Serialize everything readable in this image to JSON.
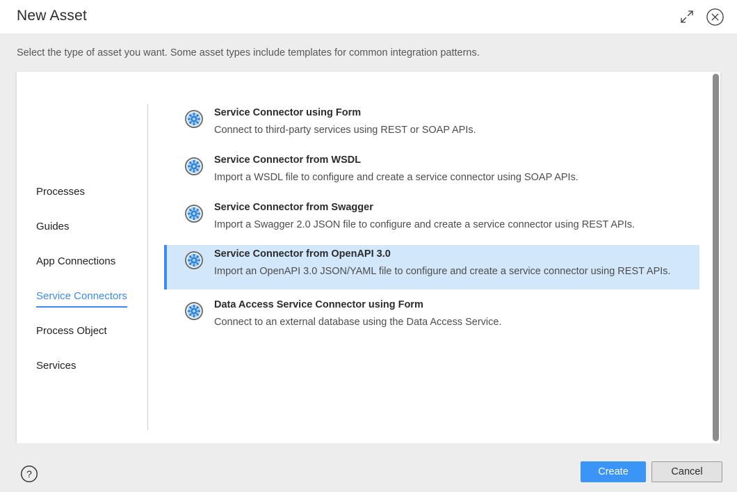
{
  "header": {
    "title": "New Asset",
    "expand_icon": "expand-diagonal-icon",
    "close_icon": "close-circle-icon"
  },
  "subtitle": "Select the type of asset you want. Some asset types include templates for common integration patterns.",
  "sidebar": {
    "items": [
      {
        "label": "Processes",
        "selected": false
      },
      {
        "label": "Guides",
        "selected": false
      },
      {
        "label": "App Connections",
        "selected": false
      },
      {
        "label": "Service Connectors",
        "selected": true
      },
      {
        "label": "Process Object",
        "selected": false
      },
      {
        "label": "Services",
        "selected": false
      }
    ]
  },
  "asset_list": {
    "items": [
      {
        "icon": "service-connector-gear-icon",
        "title": "Service Connector using Form",
        "description": "Connect to third-party services using REST or SOAP APIs.",
        "selected": false
      },
      {
        "icon": "service-connector-gear-icon",
        "title": "Service Connector from WSDL",
        "description": "Import a WSDL file to configure and create a service connector using SOAP APIs.",
        "selected": false
      },
      {
        "icon": "service-connector-gear-icon",
        "title": "Service Connector from Swagger",
        "description": "Import a Swagger 2.0 JSON file to configure and create a service connector using REST APIs.",
        "selected": false
      },
      {
        "icon": "service-connector-gear-icon",
        "title": "Service Connector from OpenAPI 3.0",
        "description": "Import an OpenAPI 3.0 JSON/YAML file to configure and create a service connector using REST APIs.",
        "selected": true
      },
      {
        "icon": "service-connector-gear-icon",
        "title": "Data Access Service Connector using Form",
        "description": "Connect to an external database using the Data Access Service.",
        "selected": false
      }
    ]
  },
  "footer": {
    "help_icon": "help-circle-icon",
    "create_label": "Create",
    "cancel_label": "Cancel"
  },
  "colors": {
    "accent_blue": "#3b8bf5",
    "primary_button": "#3b95f7",
    "selected_row_bg": "#d3e7fa",
    "dialog_bg": "#ededed",
    "panel_bg": "#ffffff",
    "scrollbar_thumb": "#8c8c8c"
  }
}
